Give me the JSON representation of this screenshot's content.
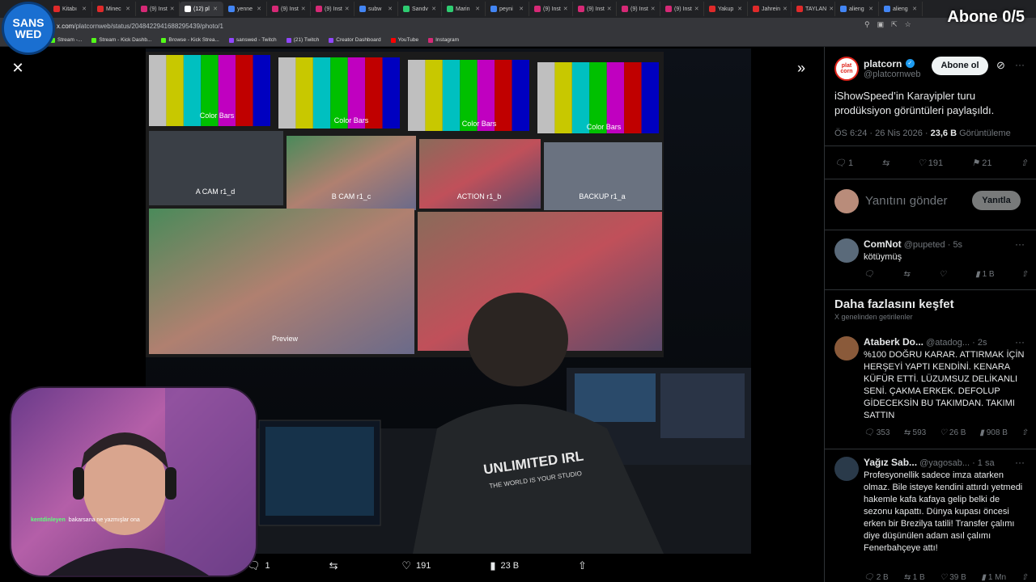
{
  "overlay": {
    "channel_logo_line1": "SANS",
    "channel_logo_line2": "WED",
    "subscriber_goal": "Abone 0/5"
  },
  "browser": {
    "tabs": [
      {
        "label": "Kitabı",
        "color": "#e02a2a"
      },
      {
        "label": "Minec",
        "color": "#e02a2a"
      },
      {
        "label": "(9) Inst",
        "color": "#d62976"
      },
      {
        "label": "(12) pl",
        "color": "#ffffff",
        "active": true
      },
      {
        "label": "yenne",
        "color": "#4285f4"
      },
      {
        "label": "(9) Inst",
        "color": "#d62976"
      },
      {
        "label": "(9) Inst",
        "color": "#d62976"
      },
      {
        "label": "subw",
        "color": "#4285f4"
      },
      {
        "label": "Sandv",
        "color": "#2ecc71"
      },
      {
        "label": "Marin",
        "color": "#2ecc71"
      },
      {
        "label": "peyni",
        "color": "#4285f4"
      },
      {
        "label": "(9) Inst",
        "color": "#d62976"
      },
      {
        "label": "(9) Inst",
        "color": "#d62976"
      },
      {
        "label": "(9) Inst",
        "color": "#d62976"
      },
      {
        "label": "(9) Inst",
        "color": "#d62976"
      },
      {
        "label": "Yakup",
        "color": "#e02a2a"
      },
      {
        "label": "Jahrein",
        "color": "#e02a2a"
      },
      {
        "label": "TAYLAN",
        "color": "#e02a2a"
      },
      {
        "label": "alieng",
        "color": "#4285f4"
      },
      {
        "label": "alieng",
        "color": "#4285f4"
      }
    ],
    "url_host": "x.com",
    "url_path": "/platcornweb/status/2048422941688295439/photo/1",
    "bookmarks": [
      {
        "label": "Stream -...",
        "color": "#53fc18"
      },
      {
        "label": "Stream - Kick Dashb...",
        "color": "#53fc18"
      },
      {
        "label": "Browse - Kick Strea...",
        "color": "#53fc18"
      },
      {
        "label": "sanswed - Twitch",
        "color": "#9146ff"
      },
      {
        "label": "(21) Twitch",
        "color": "#9146ff"
      },
      {
        "label": "Creator Dashboard",
        "color": "#9146ff"
      },
      {
        "label": "YouTube",
        "color": "#ff0000"
      },
      {
        "label": "Instagram",
        "color": "#d62976"
      }
    ]
  },
  "photo": {
    "monitor_labels": [
      "Color Bars",
      "Color Bars",
      "Color Bars",
      "Color Bars",
      "A CAM r1_d",
      "B CAM r1_c",
      "ACTION r1_b",
      "BACKUP r1_a",
      "Preview"
    ],
    "shirt_text_1": "UNLIMITED IRL",
    "shirt_text_2": "THE WORLD IS YOUR STUDIO"
  },
  "viewer_actions": {
    "replies": "1",
    "reposts": "",
    "likes": "191",
    "views": "23 B"
  },
  "stream_chat": {
    "user": "kentdinleyen",
    "message": "bakarsana ne yazmışlar ona"
  },
  "post": {
    "author": "platcorn",
    "handle": "@platcornweb",
    "avatar_text": "plat corn",
    "follow_label": "Abone ol",
    "text": "iShowSpeed’in Karayipler turu prodüksiyon görüntüleri paylaşıldı.",
    "time": "ÖS 6:24 · 26 Nis 2026 · ",
    "views_count": "23,6 B",
    "views_label": " Görüntüleme",
    "replies": "1",
    "likes": "191",
    "bookmarks": "21"
  },
  "reply_box": {
    "placeholder": "Yanıtını gönder",
    "button": "Yanıtla"
  },
  "replies": [
    {
      "name": "ComNot",
      "handle": "@pupeted · 5s",
      "text": "kötüymüş",
      "replies": "",
      "reposts": "",
      "likes": "",
      "views": "1 B"
    }
  ],
  "discover": {
    "title": "Daha fazlasını keşfet",
    "subtitle": "X genelinden getirilenler"
  },
  "discover_posts": [
    {
      "name": "Ataberk Do...",
      "handle": "@atadog... · 2s",
      "text": "%100 DOĞRU KARAR. ATTIRMAK İÇİN HERŞEYİ YAPTI KENDİNİ. KENARA KÜFÜR ETTİ. LÜZUMSUZ DELİKANLI SENİ. ÇAKMA ERKEK. DEFOLUP GİDECEKSİN BU TAKIMDAN. TAKIMI SATTIN",
      "replies": "353",
      "reposts": "593",
      "likes": "26 B",
      "views": "908 B"
    },
    {
      "name": "Yağız Sab...",
      "handle": "@yagosab... · 1 sa",
      "text": "Profesyonellik sadece imza atarken olmaz. Bile isteye kendini attırdı yetmedi hakemle kafa kafaya gelip belki de sezonu kapattı. Dünya kupası öncesi erken bir Brezilya tatili! Transfer çalımı diye düşünülen adam asıl çalımı Fenerbahçeye attı!",
      "replies": "2 B",
      "reposts": "1 B",
      "likes": "39 B",
      "views": "1 Mn"
    }
  ]
}
